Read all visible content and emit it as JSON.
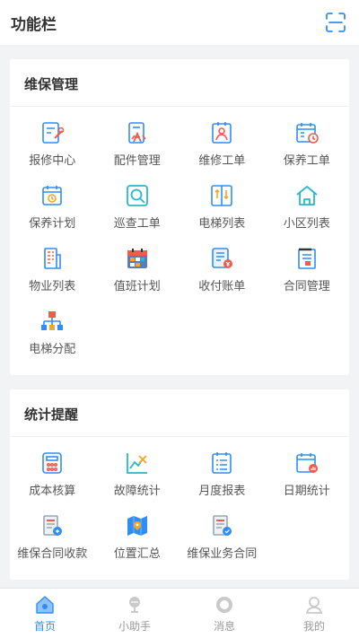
{
  "header": {
    "title": "功能栏",
    "scan_icon": "scan-icon"
  },
  "colors": {
    "accent": "#2f8ef3",
    "red": "#ef5b4c",
    "orange": "#f5a623",
    "teal": "#28b8c8"
  },
  "sections": [
    {
      "title": "维保管理",
      "items": [
        {
          "label": "报修中心",
          "icon": "repair-report-icon"
        },
        {
          "label": "配件管理",
          "icon": "parts-icon"
        },
        {
          "label": "维修工单",
          "icon": "repair-order-icon"
        },
        {
          "label": "保养工单",
          "icon": "maintenance-order-icon"
        },
        {
          "label": "保养计划",
          "icon": "maintenance-plan-icon"
        },
        {
          "label": "巡查工单",
          "icon": "inspection-icon"
        },
        {
          "label": "电梯列表",
          "icon": "elevator-icon"
        },
        {
          "label": "小区列表",
          "icon": "community-icon"
        },
        {
          "label": "物业列表",
          "icon": "property-icon"
        },
        {
          "label": "值班计划",
          "icon": "duty-calendar-icon"
        },
        {
          "label": "收付账单",
          "icon": "bill-icon"
        },
        {
          "label": "合同管理",
          "icon": "contract-icon"
        },
        {
          "label": "电梯分配",
          "icon": "allocation-icon"
        }
      ]
    },
    {
      "title": "统计提醒",
      "items": [
        {
          "label": "成本核算",
          "icon": "calculator-icon"
        },
        {
          "label": "故障统计",
          "icon": "fault-chart-icon"
        },
        {
          "label": "月度报表",
          "icon": "monthly-report-icon"
        },
        {
          "label": "日期统计",
          "icon": "date-stats-icon"
        },
        {
          "label": "维保合同收款",
          "icon": "contract-payment-icon"
        },
        {
          "label": "位置汇总",
          "icon": "location-map-icon"
        },
        {
          "label": "维保业务合同",
          "icon": "business-contract-icon"
        }
      ]
    }
  ],
  "tabs": [
    {
      "label": "首页",
      "icon": "home-icon",
      "active": true
    },
    {
      "label": "小助手",
      "icon": "assistant-icon",
      "active": false
    },
    {
      "label": "消息",
      "icon": "message-icon",
      "active": false
    },
    {
      "label": "我的",
      "icon": "profile-icon",
      "active": false
    }
  ]
}
